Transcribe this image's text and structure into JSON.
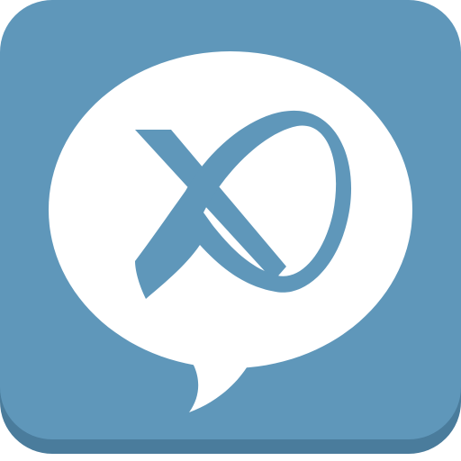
{
  "app_icon": {
    "icon": "chat-bubble-logo-icon",
    "colors": {
      "tile": "#5f97ba",
      "tile_shadow": "#4a7c9c",
      "bubble": "#ffffff",
      "mark": "#5f97ba"
    }
  }
}
